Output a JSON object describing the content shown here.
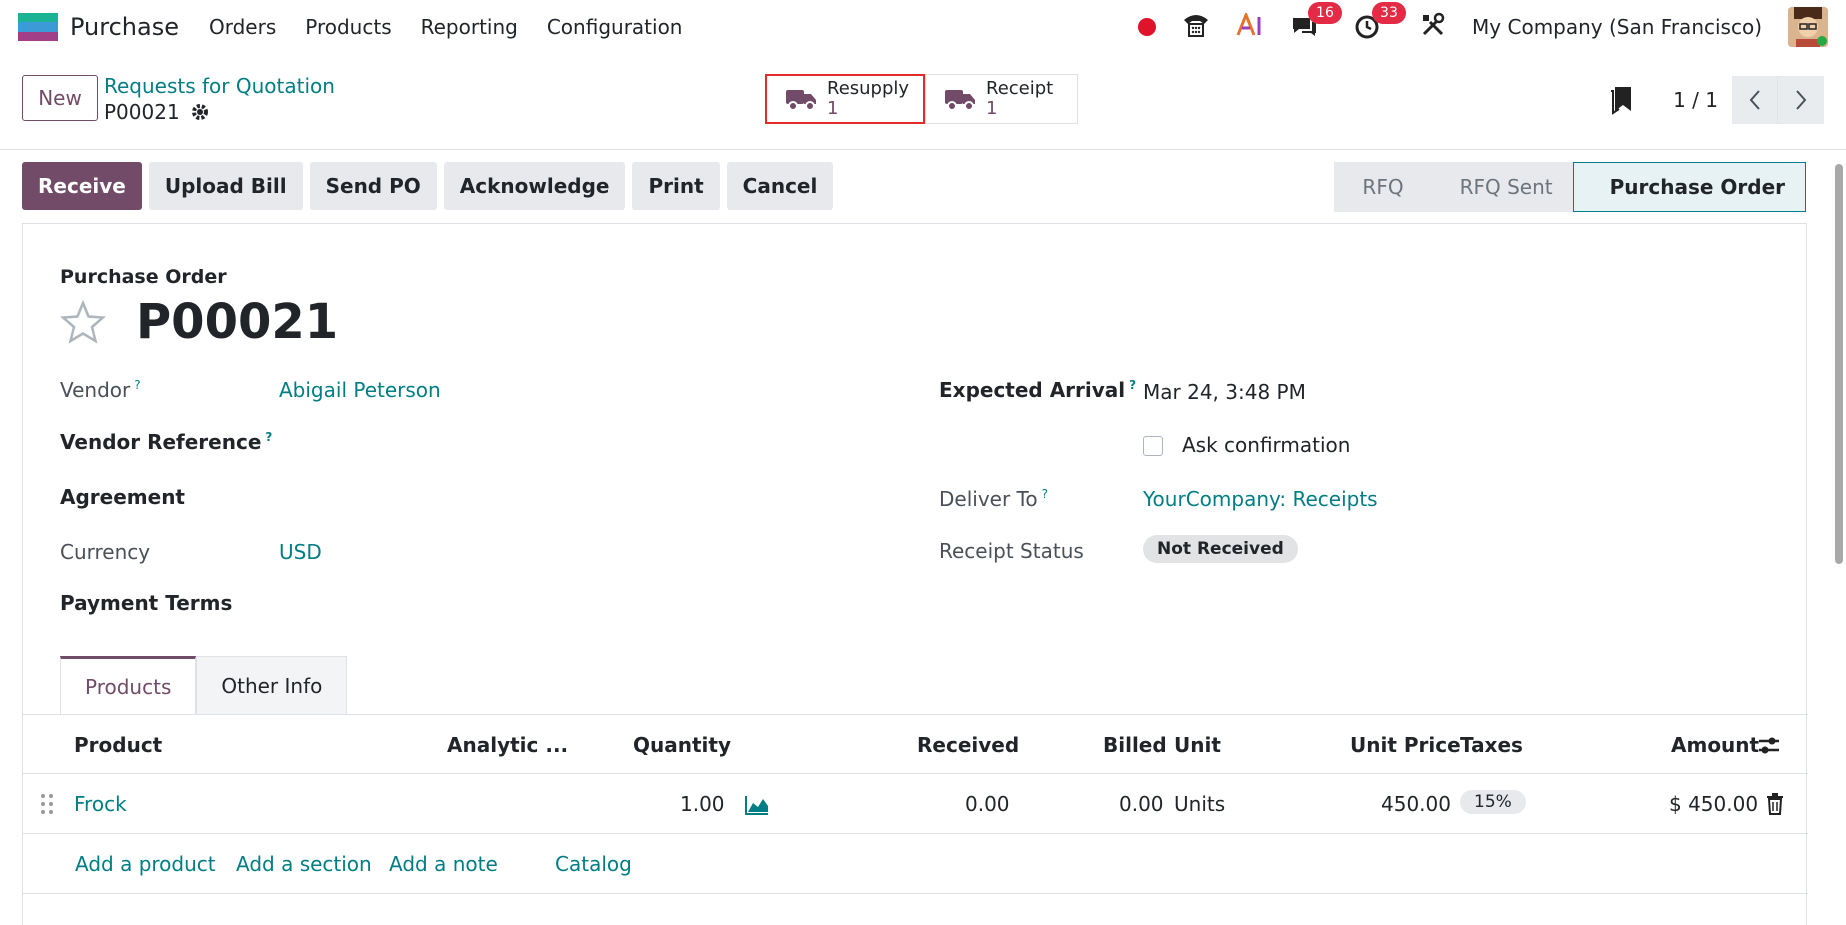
{
  "app": {
    "name": "Purchase"
  },
  "menu": [
    "Orders",
    "Products",
    "Reporting",
    "Configuration"
  ],
  "systray": {
    "messages_count": "16",
    "activities_count": "33",
    "company": "My Company (San Francisco)"
  },
  "control": {
    "new_label": "New",
    "breadcrumb": "Requests for Quotation",
    "record": "P00021",
    "smart_buttons": [
      {
        "label": "Resupply",
        "value": "1"
      },
      {
        "label": "Receipt",
        "value": "1"
      }
    ],
    "pager": "1 / 1"
  },
  "actions": [
    "Receive",
    "Upload Bill",
    "Send PO",
    "Acknowledge",
    "Print",
    "Cancel"
  ],
  "stages": [
    "RFQ",
    "RFQ Sent",
    "Purchase Order"
  ],
  "form": {
    "kind": "Purchase Order",
    "name": "P00021",
    "vendor_label": "Vendor",
    "vendor": "Abigail Peterson",
    "vendor_ref_label": "Vendor Reference",
    "agreement_label": "Agreement",
    "currency_label": "Currency",
    "currency": "USD",
    "payment_terms_label": "Payment Terms",
    "expected_arrival_label": "Expected Arrival",
    "expected_arrival": "Mar 24, 3:48 PM",
    "ask_confirmation": "Ask confirmation",
    "deliver_to_label": "Deliver To",
    "deliver_to": "YourCompany: Receipts",
    "receipt_status_label": "Receipt Status",
    "receipt_status": "Not Received",
    "help_mark": "?"
  },
  "tabs": [
    "Products",
    "Other Info"
  ],
  "table": {
    "headers": [
      "Product",
      "Analytic ...",
      "Quantity",
      "Received",
      "Billed",
      "Unit",
      "Unit Price",
      "Taxes",
      "Amount"
    ],
    "rows": [
      {
        "product": "Frock",
        "quantity": "1.00",
        "received": "0.00",
        "billed": "0.00",
        "unit": "Units",
        "unit_price": "450.00",
        "taxes": "15%",
        "amount": "$ 450.00"
      }
    ],
    "add_links": [
      "Add a product",
      "Add a section",
      "Add a note",
      "Catalog"
    ]
  }
}
